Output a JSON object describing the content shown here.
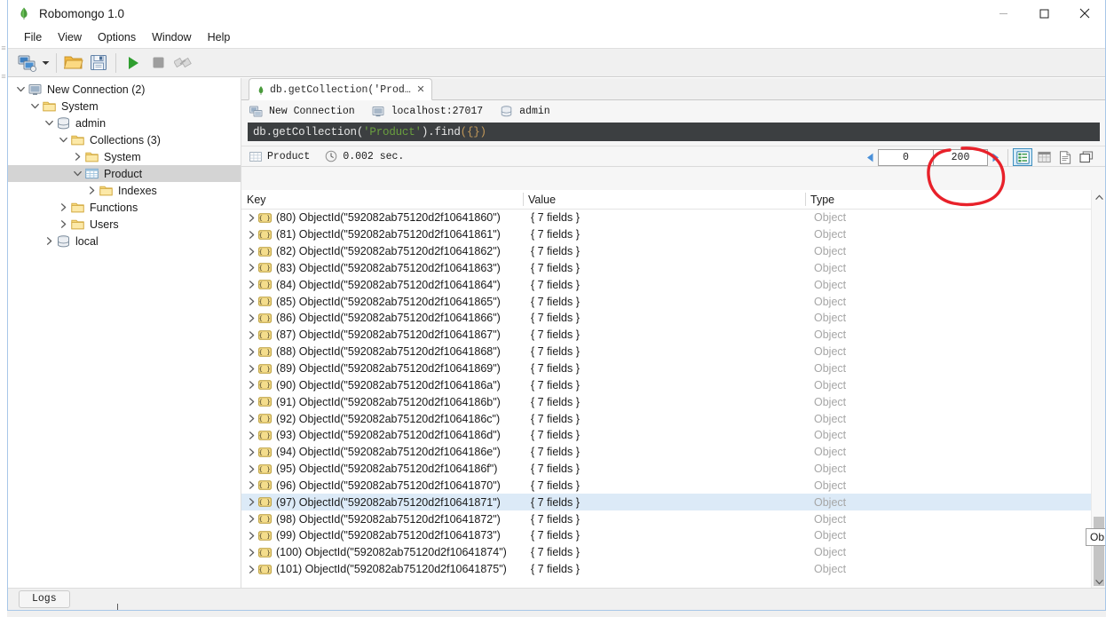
{
  "window": {
    "title": "Robomongo 1.0",
    "logo_icon": "robomongo-leaf-icon",
    "controls": [
      {
        "name": "minimize",
        "icon": "minimize-icon"
      },
      {
        "name": "maximize",
        "icon": "maximize-icon"
      },
      {
        "name": "close",
        "icon": "close-icon"
      }
    ]
  },
  "menubar": {
    "items": [
      {
        "label": "File"
      },
      {
        "label": "View"
      },
      {
        "label": "Options"
      },
      {
        "label": "Window"
      },
      {
        "label": "Help"
      }
    ]
  },
  "toolbar": {
    "buttons": [
      {
        "name": "new-connection-button",
        "icon": "connection-icon"
      },
      {
        "name": "connection-dropdown",
        "icon": "chevron-down-icon"
      },
      {
        "name": "open-script-button",
        "icon": "folder-open-icon"
      },
      {
        "name": "save-script-button",
        "icon": "floppy-disk-icon"
      },
      {
        "name": "execute-button",
        "icon": "play-icon"
      },
      {
        "name": "stop-button",
        "icon": "stop-icon"
      },
      {
        "name": "orientation-button",
        "icon": "layout-icon"
      }
    ]
  },
  "sidebar": {
    "tree": [
      {
        "label": "New Connection (2)",
        "indent": 0,
        "expanded": true,
        "icon": "server-icon",
        "selected": false
      },
      {
        "label": "System",
        "indent": 1,
        "expanded": true,
        "icon": "folder-icon",
        "selected": false
      },
      {
        "label": "admin",
        "indent": 2,
        "expanded": true,
        "icon": "database-icon",
        "selected": false
      },
      {
        "label": "Collections (3)",
        "indent": 3,
        "expanded": true,
        "icon": "folder-icon",
        "selected": false
      },
      {
        "label": "System",
        "indent": 4,
        "expanded": false,
        "icon": "folder-icon",
        "selected": false
      },
      {
        "label": "Product",
        "indent": 4,
        "expanded": true,
        "icon": "collection-icon",
        "selected": true
      },
      {
        "label": "Indexes",
        "indent": 5,
        "expanded": false,
        "icon": "folder-icon",
        "selected": false
      },
      {
        "label": "Functions",
        "indent": 3,
        "expanded": false,
        "icon": "folder-icon",
        "selected": false
      },
      {
        "label": "Users",
        "indent": 3,
        "expanded": false,
        "icon": "folder-icon",
        "selected": false
      },
      {
        "label": "local",
        "indent": 2,
        "expanded": false,
        "icon": "database-icon",
        "selected": false
      }
    ]
  },
  "tab": {
    "label": "db.getCollection('Product⋯",
    "status_icon": "green-leaf-icon",
    "close_label": "✕"
  },
  "connection_bar": {
    "connection_name": "New Connection",
    "connection_icon": "connection-icon",
    "host": "localhost:27017",
    "host_icon": "server-icon",
    "database": "admin",
    "database_icon": "database-icon"
  },
  "query_editor": {
    "prefix": "db.getCollection(",
    "string_literal": "'Product'",
    "middle": ").find",
    "braces": "({})"
  },
  "results_bar": {
    "collection_name": "Product",
    "collection_icon": "collection-icon",
    "duration": "0.002 sec.",
    "duration_icon": "clock-icon",
    "pager": {
      "prev_icon": "left-arrow-icon",
      "skip_value": "0",
      "limit_value": "200",
      "next_icon": "right-arrow-icon"
    },
    "view_modes": [
      {
        "name": "tree-view-button",
        "icon": "tree-view-icon",
        "active": true
      },
      {
        "name": "table-view-button",
        "icon": "table-view-icon",
        "active": false
      },
      {
        "name": "text-view-button",
        "icon": "document-view-icon",
        "active": false
      },
      {
        "name": "maximize-results-button",
        "icon": "expand-panel-icon",
        "active": false
      }
    ]
  },
  "grid": {
    "columns": {
      "key": "Key",
      "value": "Value",
      "type": "Type"
    },
    "rows": [
      {
        "index": "(80)",
        "id": "ObjectId(\"592082ab75120d2f10641860\")",
        "value": "{ 7 fields }",
        "type": "Object",
        "selected": false
      },
      {
        "index": "(81)",
        "id": "ObjectId(\"592082ab75120d2f10641861\")",
        "value": "{ 7 fields }",
        "type": "Object",
        "selected": false
      },
      {
        "index": "(82)",
        "id": "ObjectId(\"592082ab75120d2f10641862\")",
        "value": "{ 7 fields }",
        "type": "Object",
        "selected": false
      },
      {
        "index": "(83)",
        "id": "ObjectId(\"592082ab75120d2f10641863\")",
        "value": "{ 7 fields }",
        "type": "Object",
        "selected": false
      },
      {
        "index": "(84)",
        "id": "ObjectId(\"592082ab75120d2f10641864\")",
        "value": "{ 7 fields }",
        "type": "Object",
        "selected": false
      },
      {
        "index": "(85)",
        "id": "ObjectId(\"592082ab75120d2f10641865\")",
        "value": "{ 7 fields }",
        "type": "Object",
        "selected": false
      },
      {
        "index": "(86)",
        "id": "ObjectId(\"592082ab75120d2f10641866\")",
        "value": "{ 7 fields }",
        "type": "Object",
        "selected": false
      },
      {
        "index": "(87)",
        "id": "ObjectId(\"592082ab75120d2f10641867\")",
        "value": "{ 7 fields }",
        "type": "Object",
        "selected": false
      },
      {
        "index": "(88)",
        "id": "ObjectId(\"592082ab75120d2f10641868\")",
        "value": "{ 7 fields }",
        "type": "Object",
        "selected": false
      },
      {
        "index": "(89)",
        "id": "ObjectId(\"592082ab75120d2f10641869\")",
        "value": "{ 7 fields }",
        "type": "Object",
        "selected": false
      },
      {
        "index": "(90)",
        "id": "ObjectId(\"592082ab75120d2f1064186a\")",
        "value": "{ 7 fields }",
        "type": "Object",
        "selected": false
      },
      {
        "index": "(91)",
        "id": "ObjectId(\"592082ab75120d2f1064186b\")",
        "value": "{ 7 fields }",
        "type": "Object",
        "selected": false
      },
      {
        "index": "(92)",
        "id": "ObjectId(\"592082ab75120d2f1064186c\")",
        "value": "{ 7 fields }",
        "type": "Object",
        "selected": false
      },
      {
        "index": "(93)",
        "id": "ObjectId(\"592082ab75120d2f1064186d\")",
        "value": "{ 7 fields }",
        "type": "Object",
        "selected": false
      },
      {
        "index": "(94)",
        "id": "ObjectId(\"592082ab75120d2f1064186e\")",
        "value": "{ 7 fields }",
        "type": "Object",
        "selected": false
      },
      {
        "index": "(95)",
        "id": "ObjectId(\"592082ab75120d2f1064186f\")",
        "value": "{ 7 fields }",
        "type": "Object",
        "selected": false
      },
      {
        "index": "(96)",
        "id": "ObjectId(\"592082ab75120d2f10641870\")",
        "value": "{ 7 fields }",
        "type": "Object",
        "selected": false
      },
      {
        "index": "(97)",
        "id": "ObjectId(\"592082ab75120d2f10641871\")",
        "value": "{ 7 fields }",
        "type": "Object",
        "selected": true
      },
      {
        "index": "(98)",
        "id": "ObjectId(\"592082ab75120d2f10641872\")",
        "value": "{ 7 fields }",
        "type": "Object",
        "selected": false
      },
      {
        "index": "(99)",
        "id": "ObjectId(\"592082ab75120d2f10641873\")",
        "value": "{ 7 fields }",
        "type": "Object",
        "selected": false
      },
      {
        "index": "(100)",
        "id": "ObjectId(\"592082ab75120d2f10641874\")",
        "value": "{ 7 fields }",
        "type": "Object",
        "selected": false
      },
      {
        "index": "(101)",
        "id": "ObjectId(\"592082ab75120d2f10641875\")",
        "value": "{ 7 fields }",
        "type": "Object",
        "selected": false
      }
    ],
    "row_icon": "json-document-icon",
    "expand_icon": "chevron-right-icon"
  },
  "tooltip": {
    "text": "Ob"
  },
  "statusbar": {
    "logs_label": "Logs"
  },
  "annotation": {
    "shape": "hand-drawn-ellipse",
    "color": "#e8212a",
    "target": "limit-field"
  },
  "colors": {
    "accent": "#3c8fbf",
    "selection": "#dceaf7",
    "tree_selection": "#d4d4d4",
    "editor_bg": "#3c3f41",
    "annotation_red": "#e8212a",
    "type_text": "#a6a6a6"
  }
}
